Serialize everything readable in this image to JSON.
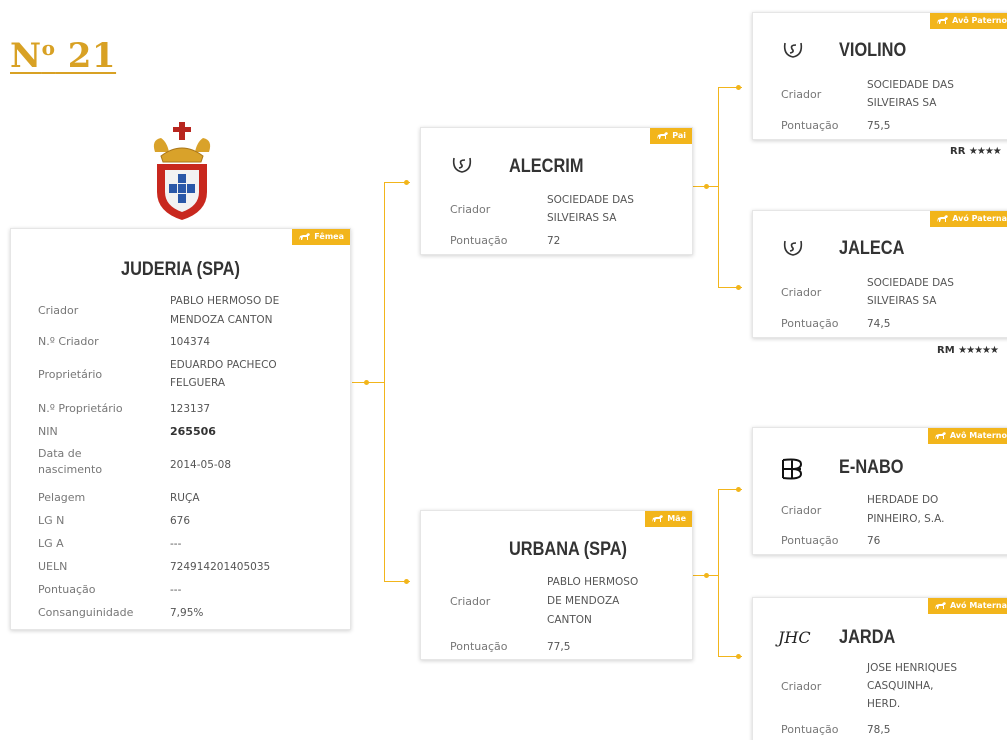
{
  "lot": {
    "prefix": "N",
    "sup": "o",
    "number": " 21"
  },
  "colors": {
    "accent": "#f2b51b",
    "title": "#d8a124"
  },
  "horse_icon": "horse-icon",
  "labels": {
    "criador": "Criador",
    "n_criador": "N.º Criador",
    "proprietario": "Proprietário",
    "n_proprietario": "N.º Proprietário",
    "nin": "NIN",
    "data_nasc_1": "Data de",
    "data_nasc_2": "nascimento",
    "pelagem": "Pelagem",
    "lg_n": "LG N",
    "lg_a": "LG A",
    "ueln": "UELN",
    "pontuacao": "Pontuação",
    "consanguinidade": "Consanguinidade"
  },
  "main": {
    "badge": "Fêmea",
    "name": "JUDERIA (SPA)",
    "criador": [
      "PABLO HERMOSO DE",
      "MENDOZA CANTON"
    ],
    "n_criador": "104374",
    "proprietario": [
      "EDUARDO PACHECO",
      "FELGUERA"
    ],
    "n_proprietario": "123137",
    "nin": "265506",
    "data_nascimento": "2014-05-08",
    "pelagem": "RUÇA",
    "lg_n": "676",
    "lg_a": "---",
    "ueln": "724914201405035",
    "pontuacao": "---",
    "consanguinidade": "7,95%"
  },
  "pai": {
    "badge": "Pai",
    "name": "ALECRIM",
    "brand": "S-brand",
    "criador": [
      "SOCIEDADE DAS",
      "SILVEIRAS SA"
    ],
    "pontuacao": "72"
  },
  "mae": {
    "badge": "Mãe",
    "name": "URBANA (SPA)",
    "criador": [
      "PABLO HERMOSO",
      "DE MENDOZA",
      "CANTON"
    ],
    "pontuacao": "77,5"
  },
  "avo_pp": {
    "badge": "Avô Paterno",
    "name": "VIOLINO",
    "brand": "S-brand",
    "criador": [
      "SOCIEDADE DAS",
      "SILVEIRAS SA"
    ],
    "pontuacao": "75,5",
    "rating": "RR",
    "stars": "★★★★"
  },
  "avo_pm": {
    "badge": "Avó Paterna",
    "name": "JALECA",
    "brand": "S-brand",
    "criador": [
      "SOCIEDADE DAS",
      "SILVEIRAS SA"
    ],
    "pontuacao": "74,5",
    "rating": "RM",
    "stars": "★★★★★"
  },
  "avo_mp": {
    "badge": "Avô Materno",
    "name": "E-NABO",
    "brand": "HD-brand",
    "criador": [
      "HERDADE DO",
      "PINHEIRO, S.A."
    ],
    "pontuacao": "76"
  },
  "avo_mm": {
    "badge": "Avó Materna",
    "name": "JARDA",
    "brand": "JHC",
    "criador": [
      "JOSE HENRIQUES",
      "CASQUINHA,",
      "HERD."
    ],
    "pontuacao": "78,5"
  }
}
